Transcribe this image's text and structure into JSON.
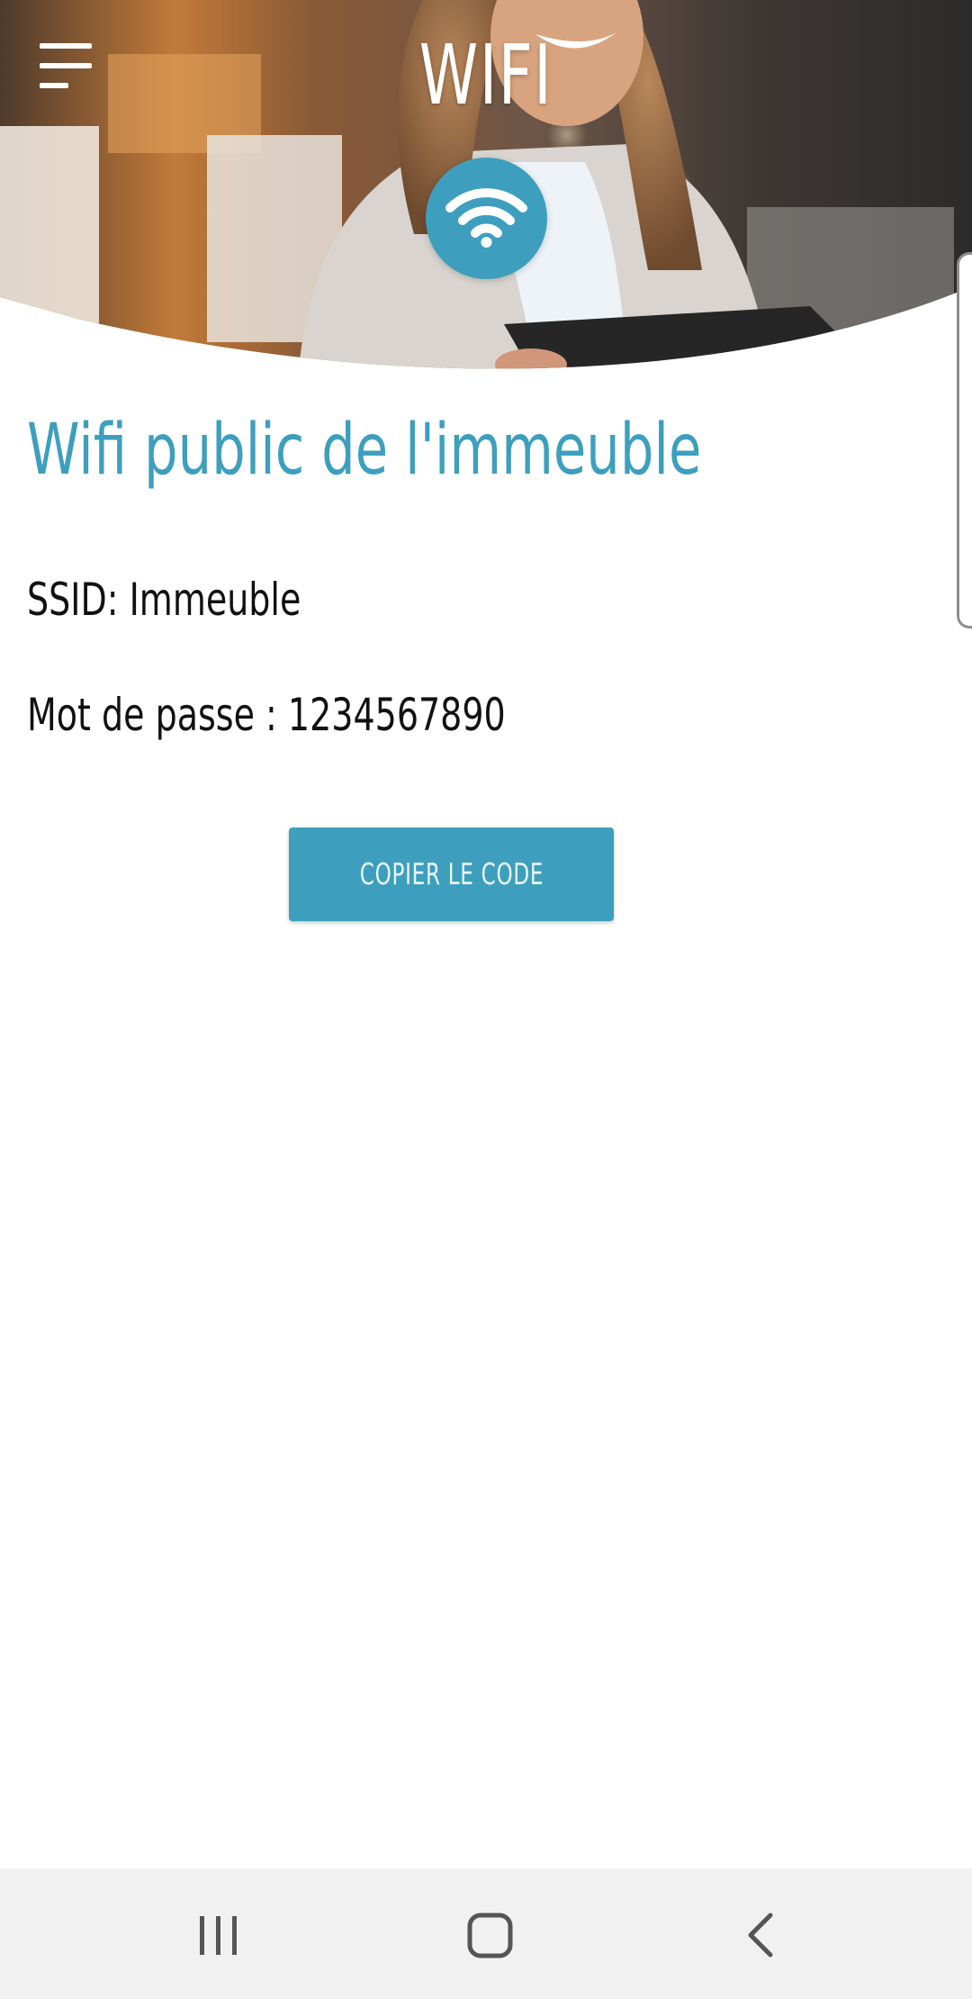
{
  "header": {
    "title": "WIFI",
    "menu_icon": "hamburger-menu-icon",
    "badge_icon": "wifi-icon"
  },
  "content": {
    "section_title": "Wifi public de l'immeuble",
    "ssid_line": "SSID: Immeuble",
    "password_line": "Mot de passe : 1234567890",
    "copy_button_label": "COPIER LE CODE"
  },
  "nav_bar": {
    "recents_icon": "recent-apps-icon",
    "home_icon": "home-icon",
    "back_icon": "back-icon"
  },
  "colors": {
    "accent": "#3d9fbd",
    "text": "#111111",
    "nav_background": "#f1f1f1"
  }
}
